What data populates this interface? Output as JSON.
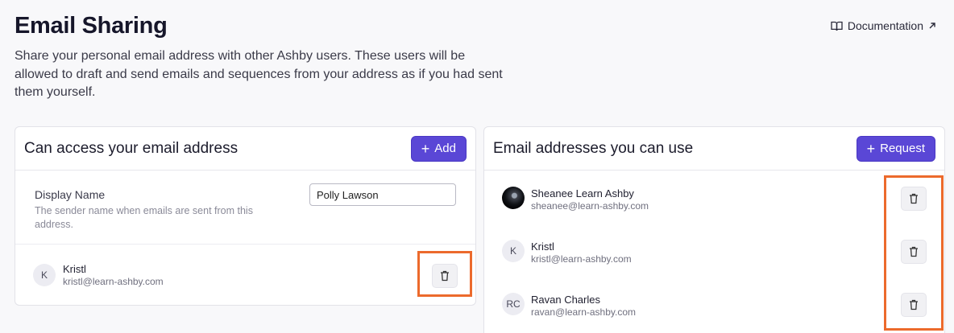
{
  "page": {
    "title": "Email Sharing",
    "description": "Share your personal email address with other Ashby users. These users will be allowed to draft and send emails and sequences from your address as if you had sent them yourself.",
    "doc_link": "Documentation"
  },
  "left_card": {
    "title": "Can access your email address",
    "add_label": "Add",
    "display_name": {
      "label": "Display Name",
      "help": "The sender name when emails are sent from this address.",
      "value": "Polly Lawson"
    },
    "people": [
      {
        "initials": "K",
        "name": "Kristl",
        "email": "kristl@learn-ashby.com"
      }
    ]
  },
  "right_card": {
    "title": "Email addresses you can use",
    "request_label": "Request",
    "people": [
      {
        "initials": "",
        "name": "Sheanee Learn Ashby",
        "email": "sheanee@learn-ashby.com"
      },
      {
        "initials": "K",
        "name": "Kristl",
        "email": "kristl@learn-ashby.com"
      },
      {
        "initials": "RC",
        "name": "Ravan Charles",
        "email": "ravan@learn-ashby.com"
      }
    ]
  },
  "colors": {
    "primary": "#5a47d6",
    "highlight": "#ec6a2c"
  }
}
